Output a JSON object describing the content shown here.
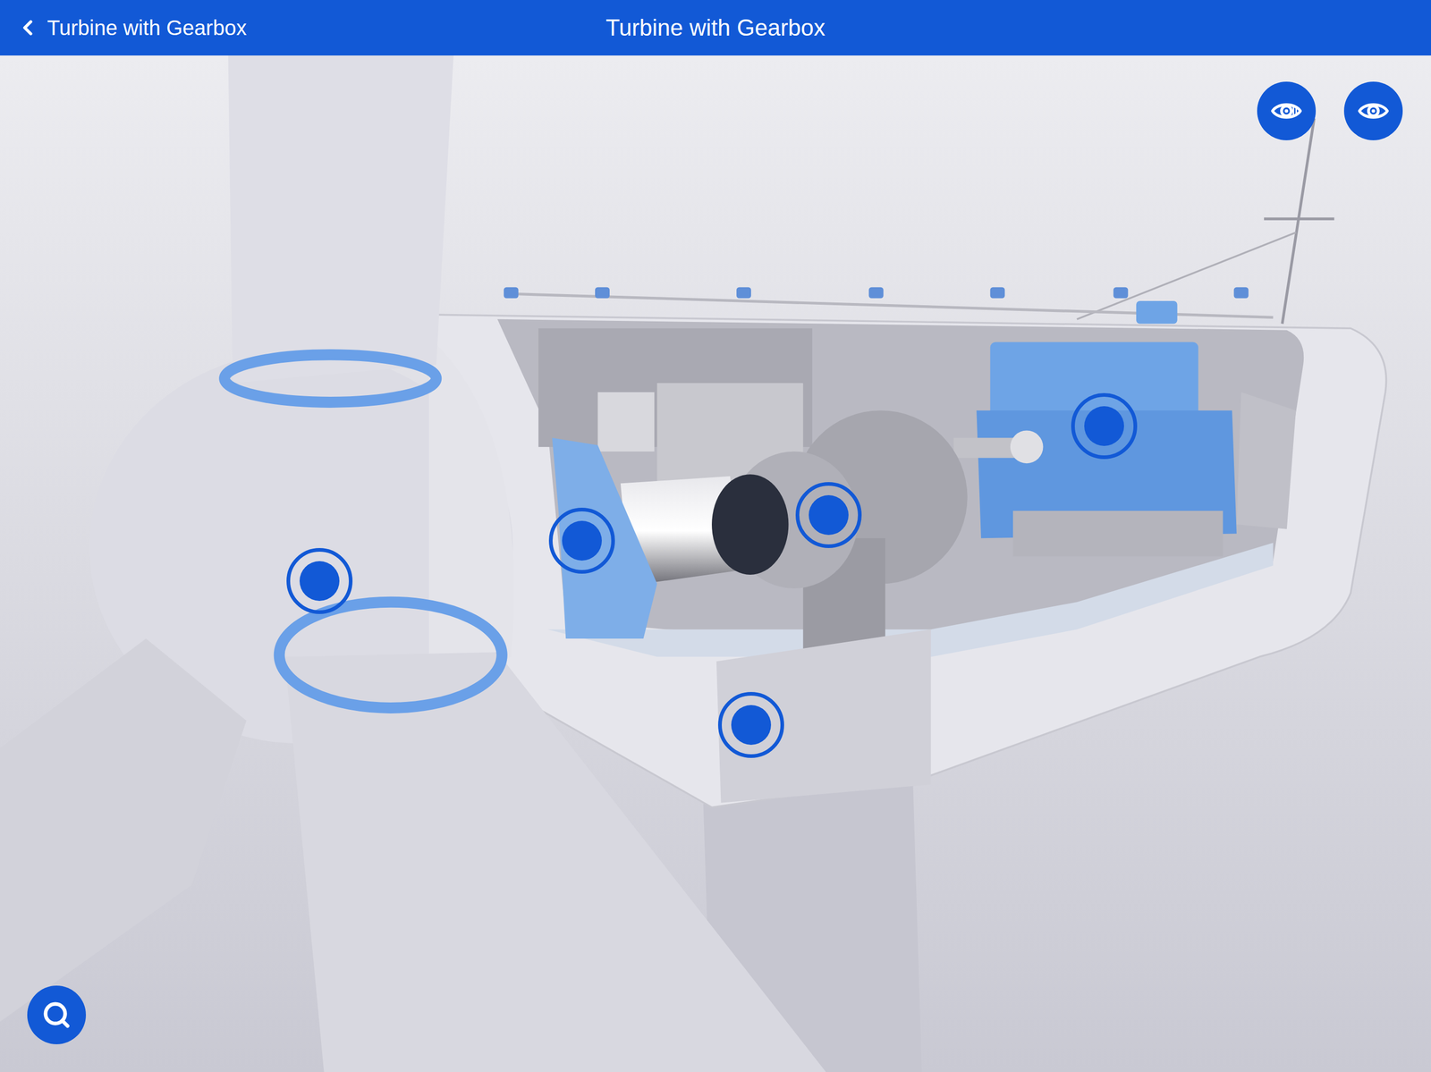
{
  "header": {
    "back_label": "Turbine with Gearbox",
    "title": "Turbine with Gearbox"
  }
}
